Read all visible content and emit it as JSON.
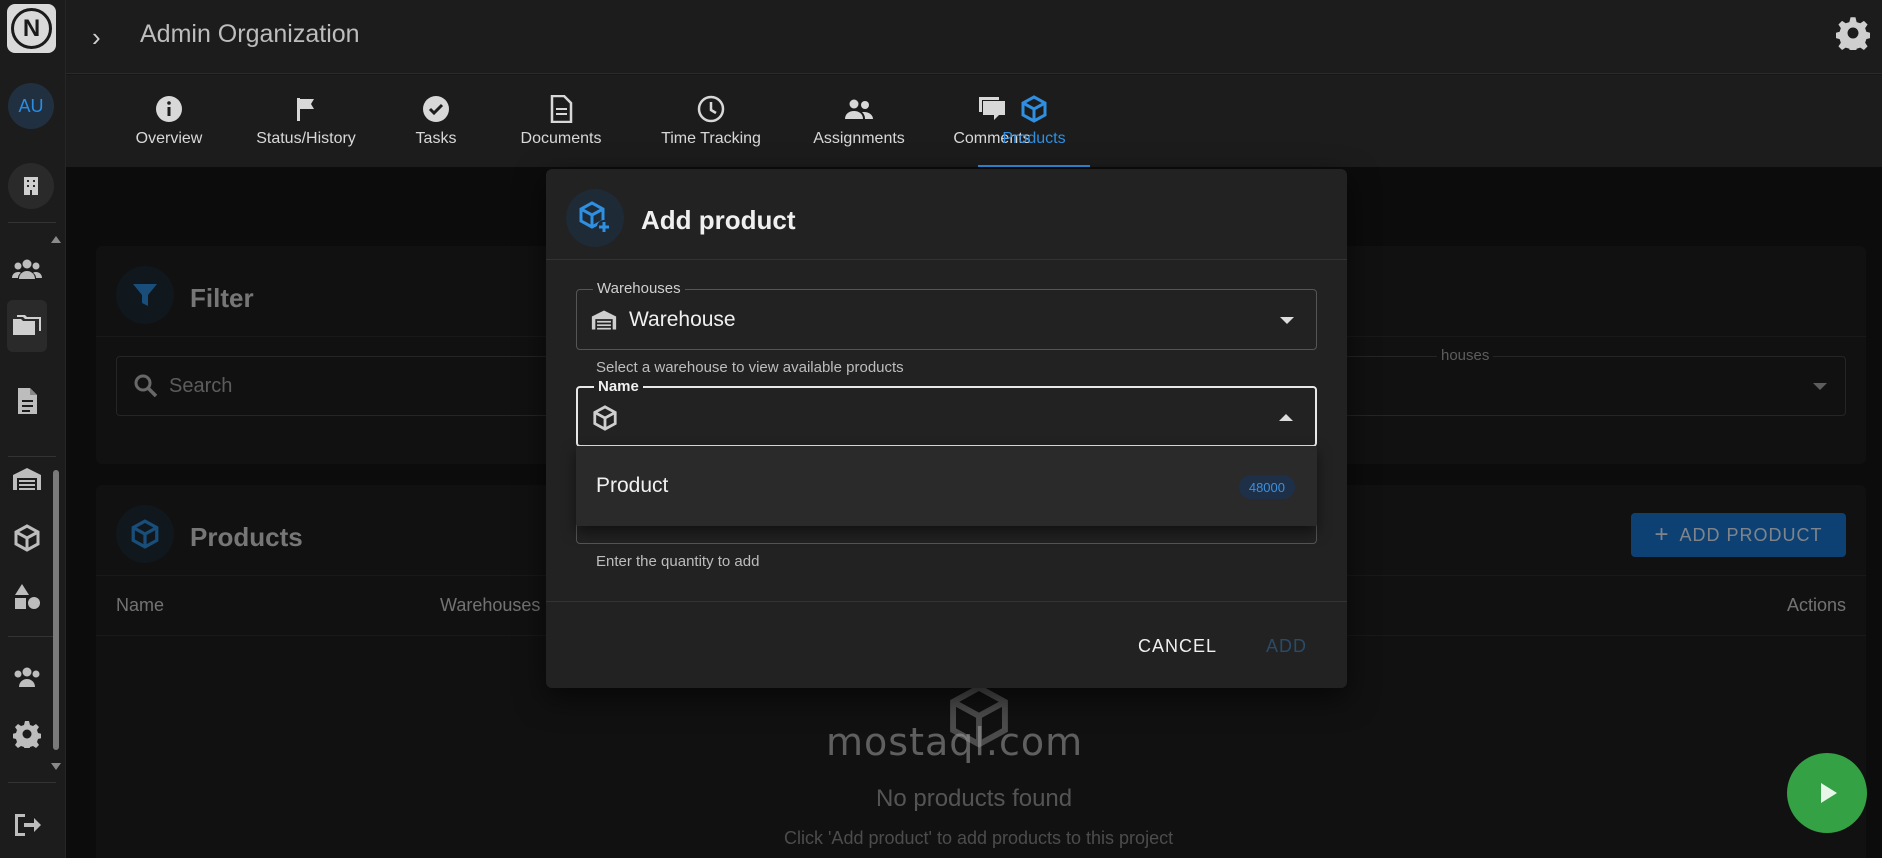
{
  "app": {
    "title": "Admin Organization"
  },
  "rail": {
    "avatar_initials": "AU"
  },
  "tabs": [
    {
      "label": "Overview",
      "icon": "info-icon"
    },
    {
      "label": "Status/History",
      "icon": "flag-icon"
    },
    {
      "label": "Tasks",
      "icon": "check-circle-icon"
    },
    {
      "label": "Documents",
      "icon": "document-icon"
    },
    {
      "label": "Time Tracking",
      "icon": "clock-icon"
    },
    {
      "label": "Assignments",
      "icon": "people-icon"
    },
    {
      "label": "Comments",
      "icon": "comments-icon"
    },
    {
      "label": "Products",
      "icon": "cube-icon",
      "active": true
    }
  ],
  "filter": {
    "title": "Filter",
    "search_placeholder": "Search",
    "warehouses_label": "houses"
  },
  "products": {
    "title": "Products",
    "add_button": "ADD PRODUCT",
    "columns": {
      "name": "Name",
      "warehouses": "Warehouses",
      "actions": "Actions"
    },
    "empty_title": "No products found",
    "empty_subtitle": "Click 'Add product' to add products to this project"
  },
  "dialog": {
    "title": "Add product",
    "warehouse_field": {
      "label": "Warehouses",
      "value": "Warehouse",
      "helper": "Select a warehouse to view available products"
    },
    "name_field": {
      "label": "Name",
      "value": ""
    },
    "quantity_helper": "Enter the quantity to add",
    "cancel": "CANCEL",
    "add": "ADD",
    "options": [
      {
        "label": "Product",
        "badge": "48000"
      }
    ]
  },
  "watermark": "mostaql.com",
  "colors": {
    "accent": "#2f8fe0",
    "primary_button": "#1976d2",
    "fab": "#34a144"
  }
}
